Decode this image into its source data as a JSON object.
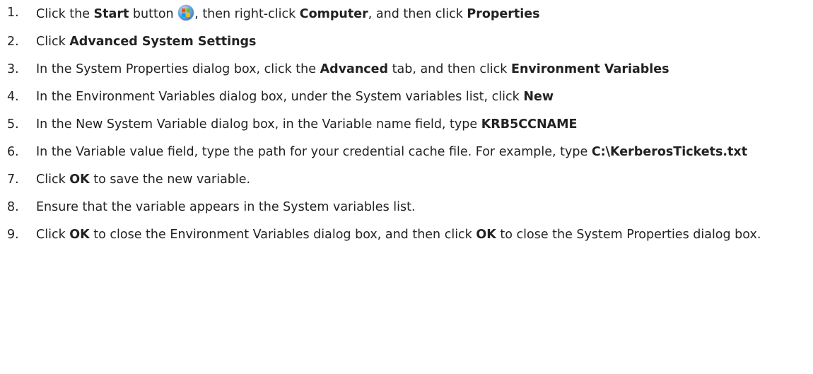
{
  "steps": [
    {
      "number": "1.",
      "t1": "Click the ",
      "b1": "Start",
      "t2": " button ",
      "icon": "windows-start-orb-icon",
      "t3": ", then right-click ",
      "b2": "Computer",
      "t4": ", and then click ",
      "b3": "Properties"
    },
    {
      "number": "2.",
      "t1": "Click ",
      "b1": "Advanced System Settings"
    },
    {
      "number": "3.",
      "t1": "In the System Properties dialog box, click the ",
      "b1": "Advanced",
      "t2": " tab, and then click ",
      "b2": "Environment Variables"
    },
    {
      "number": "4.",
      "t1": "In the Environment Variables dialog box, under the System variables list, click ",
      "b1": "New"
    },
    {
      "number": "5.",
      "t1": "In the New System Variable dialog box, in the Variable name field, type ",
      "b1": "KRB5CCNAME"
    },
    {
      "number": "6.",
      "t1": "In the Variable value field, type the path for your credential cache file. For example, type ",
      "b1": "C:\\KerberosTickets.txt"
    },
    {
      "number": "7.",
      "t1": "Click ",
      "b1": "OK",
      "t2": " to save the new variable."
    },
    {
      "number": "8.",
      "t1": "Ensure that the variable appears in the System variables list."
    },
    {
      "number": "9.",
      "t1": "Click ",
      "b1": "OK",
      "t2": " to close the Environment Variables dialog box, and then click ",
      "b2": "OK",
      "t3": " to close the System Properties dialog box."
    }
  ]
}
